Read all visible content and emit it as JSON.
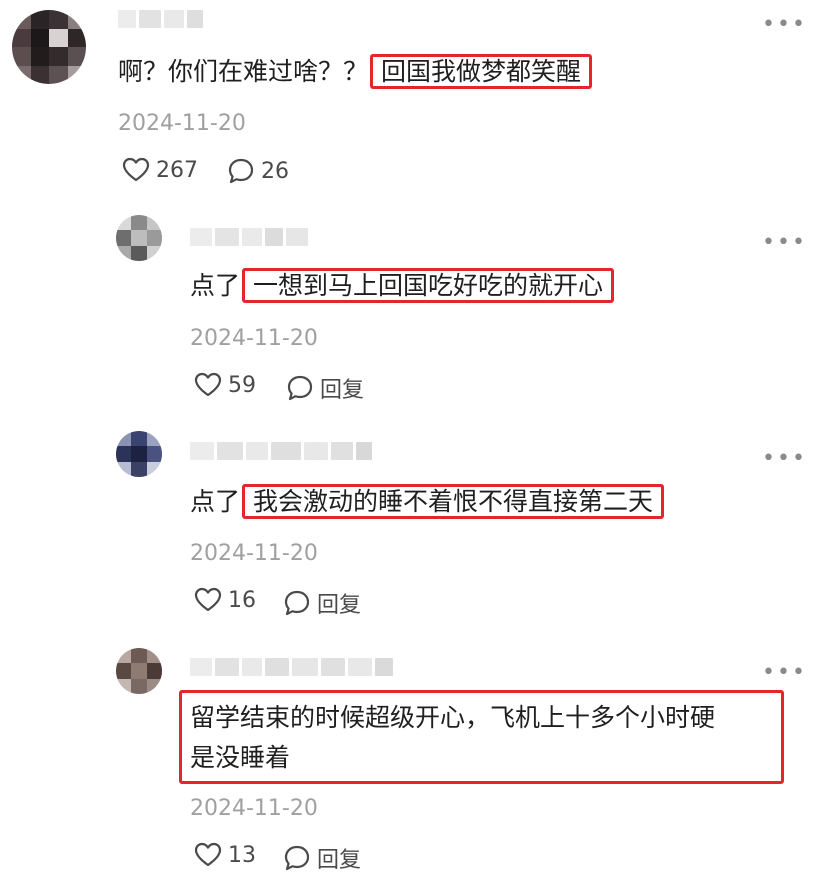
{
  "comments": [
    {
      "prefix": "啊？你们在难过啥？？",
      "highlight": "回国我做梦都笑醒",
      "date": "2024-11-20",
      "likes": "267",
      "replies": "26",
      "more_label": "•••"
    },
    {
      "prefix": "点了",
      "highlight": "一想到马上回国吃好吃的就开心",
      "date": "2024-11-20",
      "likes": "59",
      "reply_label": "回复",
      "more_label": "•••"
    },
    {
      "prefix": "点了",
      "highlight": "我会激动的睡不着恨不得直接第二天",
      "date": "2024-11-20",
      "likes": "16",
      "reply_label": "回复",
      "more_label": "•••"
    },
    {
      "line1": "留学结束的时候超级开心，飞机上十多个小时硬",
      "line2": "是没睡着",
      "date": "2024-11-20",
      "likes": "13",
      "reply_label": "回复",
      "more_label": "•••"
    }
  ],
  "colors": {
    "highlight_border": "#e3262c",
    "date_text": "#a0a0a0",
    "action_text": "#4a4a4a"
  },
  "icons": [
    "heart-icon",
    "comment-bubble-icon",
    "more-dots-icon"
  ]
}
